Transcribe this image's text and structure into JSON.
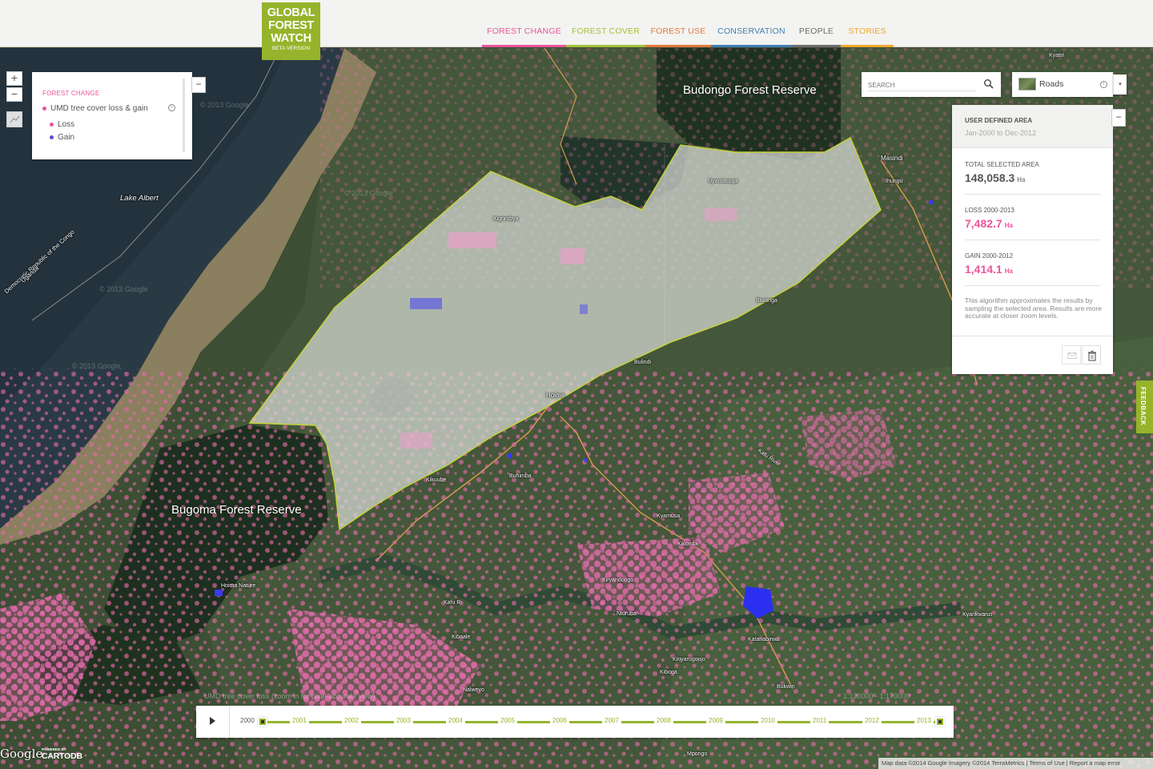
{
  "header": {
    "logo": {
      "line1": "GLOBAL",
      "line2": "FOREST",
      "line3": "WATCH",
      "line4": "BETA VERSION"
    },
    "nav": [
      {
        "label": "FOREST CHANGE",
        "color": "#e9559a"
      },
      {
        "label": "FOREST COVER",
        "color": "#a3c13c"
      },
      {
        "label": "FOREST USE",
        "color": "#e07a3a"
      },
      {
        "label": "CONSERVATION",
        "color": "#3f7fb4"
      },
      {
        "label": "PEOPLE",
        "color": "#6c6c6c"
      },
      {
        "label": "STORIES",
        "color": "#f0a82d"
      }
    ]
  },
  "zoom": {
    "in": "+",
    "out": "−"
  },
  "layers_panel": {
    "title": "FOREST CHANGE",
    "layer_name": "UMD tree cover loss & gain",
    "legend": [
      {
        "label": "Loss",
        "color": "#e9559a"
      },
      {
        "label": "Gain",
        "color": "#5a4fd1"
      }
    ],
    "collapse": "−",
    "info": "i"
  },
  "search": {
    "placeholder": "SEARCH"
  },
  "basemap": {
    "label": "Roads",
    "info": "i",
    "dropdown": "▾"
  },
  "analysis": {
    "title": "USER DEFINED AREA",
    "date_range": "Jan-2000 to Dec-2012",
    "collapse": "−",
    "total_label": "TOTAL SELECTED AREA",
    "total_value": "148,058.3",
    "loss_label": "LOSS 2000-2013",
    "loss_value": "7,482.7",
    "gain_label": "GAIN 2000-2012",
    "gain_value": "1,414.1",
    "unit": "Ha",
    "note": "This algorithm approximates the results by sampling the selected area. Results are more accurate at closer zoom levels."
  },
  "feedback": {
    "label": "FEEDBACK"
  },
  "map_labels": {
    "budongo": "Budongo Forest Reserve",
    "bugoma": "Bugoma Forest Reserve",
    "lake_albert": "Lake Albert",
    "border": "Democratic Republic of the Congo",
    "uganda": "Uganda",
    "places": [
      "Kyatiri",
      "Masindi",
      "Ihungu",
      "Nyamasoga",
      "Kigorobya",
      "Biwanga",
      "Bulindi",
      "Hoima",
      "Buhimba",
      "Kikuube",
      "Kafu River",
      "Kyamusa",
      "Kikonda",
      "Kiryandongo",
      "Kafu Ri",
      "Nturuba",
      "Katanabirwa",
      "Kyankwanzi",
      "Kiboga",
      "Bukwiri",
      "Mpongo",
      "Kinyarugonjo",
      "Kibaale",
      "Nalweyo",
      "Hoima Nature"
    ]
  },
  "watermarks": [
    "© 2013 Google",
    "© 2013 Google",
    "© 2013 Google",
    "© 2013 Google"
  ],
  "legend_hint": "UMD tree cover loss (zoom in for pixel-accurate view)",
  "scale_text": "1:120000 - 1:170000",
  "timeline": {
    "play": "▶",
    "years": [
      "2000",
      "2001",
      "2002",
      "2003",
      "2004",
      "2005",
      "2006",
      "2007",
      "2008",
      "2009",
      "2010",
      "2011",
      "2012",
      "2013"
    ]
  },
  "footer": {
    "google": "Google",
    "powered_by": "POWERED BY",
    "cartodb": "CARTODB",
    "attribution": "Map data ©2014 Google Imagery ©2014 TerraMetrics | Terms of Use | Report a map error"
  }
}
